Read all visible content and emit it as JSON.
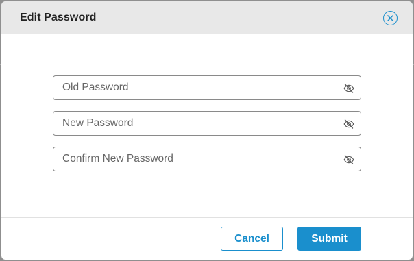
{
  "dialog": {
    "title": "Edit Password",
    "close_icon": "close-circle-icon"
  },
  "form": {
    "fields": [
      {
        "placeholder": "Old Password",
        "value": "",
        "icon": "eye-slash-icon"
      },
      {
        "placeholder": "New Password",
        "value": "",
        "icon": "eye-slash-icon"
      },
      {
        "placeholder": "Confirm New Password",
        "value": "",
        "icon": "eye-slash-icon"
      }
    ]
  },
  "footer": {
    "cancel_label": "Cancel",
    "submit_label": "Submit"
  },
  "colors": {
    "accent": "#1a8fcd",
    "header_bg": "#e8e8e8",
    "overlay": "#8f8f8f"
  }
}
